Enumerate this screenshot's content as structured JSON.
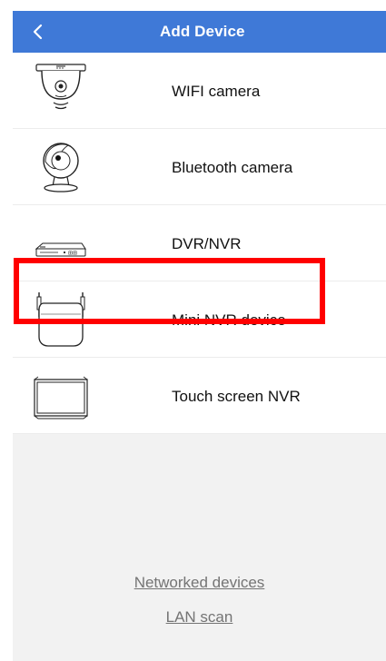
{
  "header": {
    "back_icon": "chevron-left-icon",
    "title": "Add Device",
    "color": "#3f79d7"
  },
  "devices": [
    {
      "label": "WIFI camera",
      "icon": "dome-camera-icon"
    },
    {
      "label": "Bluetooth camera",
      "icon": "bluetooth-camera-icon"
    },
    {
      "label": "DVR/NVR",
      "icon": "dvr-icon",
      "highlighted": true
    },
    {
      "label": "Mini NVR device",
      "icon": "mini-nvr-icon"
    },
    {
      "label": "Touch screen NVR",
      "icon": "touch-screen-nvr-icon"
    }
  ],
  "links": {
    "networked_devices": "Networked devices",
    "lan_scan": "LAN scan"
  },
  "highlight_color": "#ff0000"
}
